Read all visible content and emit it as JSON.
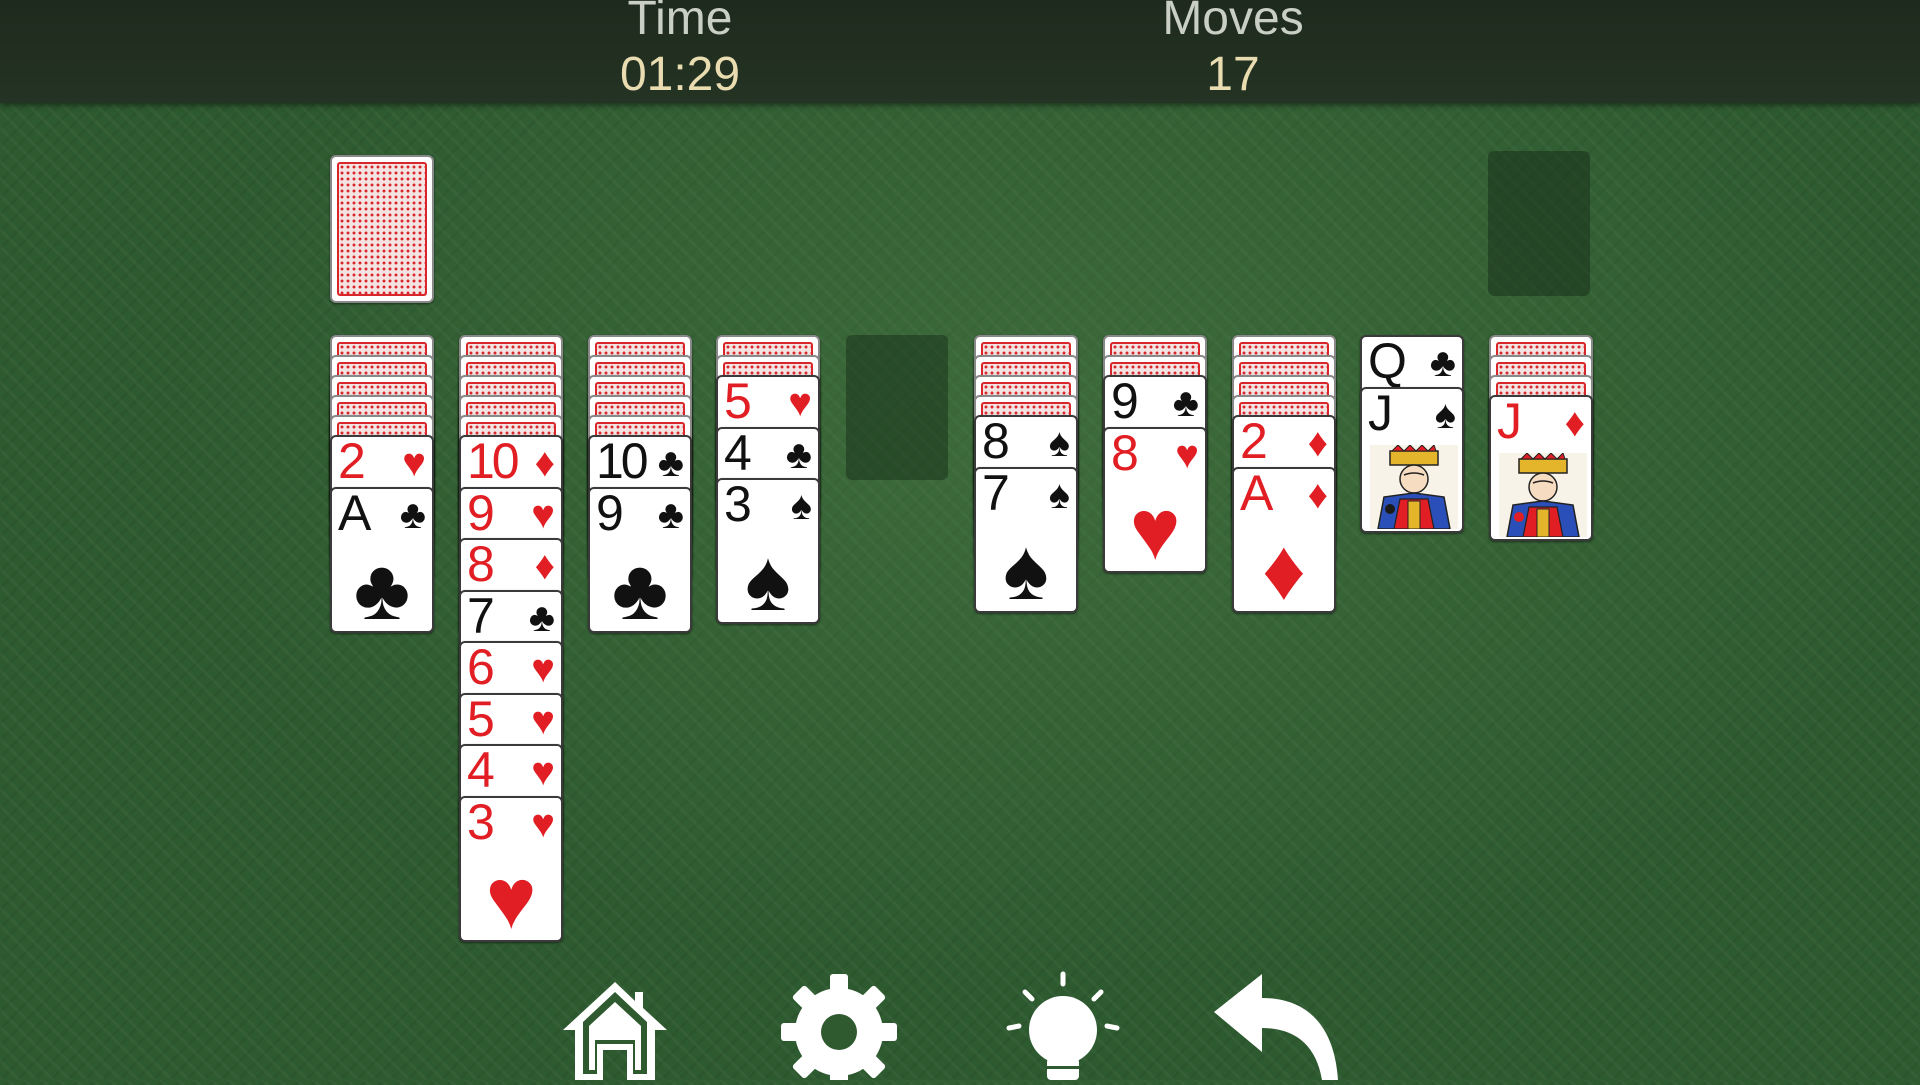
{
  "header": {
    "time_label": "Time",
    "time_value": "01:29",
    "moves_label": "Moves",
    "moves_value": "17"
  },
  "stock": {
    "cards": "face-down"
  },
  "foundation_slot": {
    "state": "empty"
  },
  "tableau": [
    {
      "face_down": 5,
      "cards": [
        {
          "rank": "2",
          "suit": "♥",
          "color": "red"
        },
        {
          "rank": "A",
          "suit": "♣",
          "color": "black"
        }
      ]
    },
    {
      "face_down": 5,
      "cards": [
        {
          "rank": "10",
          "suit": "♦",
          "color": "red"
        },
        {
          "rank": "9",
          "suit": "♥",
          "color": "red"
        },
        {
          "rank": "8",
          "suit": "♦",
          "color": "red"
        },
        {
          "rank": "7",
          "suit": "♣",
          "color": "black"
        },
        {
          "rank": "6",
          "suit": "♥",
          "color": "red"
        },
        {
          "rank": "5",
          "suit": "♥",
          "color": "red"
        },
        {
          "rank": "4",
          "suit": "♥",
          "color": "red"
        },
        {
          "rank": "3",
          "suit": "♥",
          "color": "red"
        }
      ]
    },
    {
      "face_down": 5,
      "cards": [
        {
          "rank": "10",
          "suit": "♣",
          "color": "black"
        },
        {
          "rank": "9",
          "suit": "♣",
          "color": "black"
        }
      ]
    },
    {
      "face_down": 2,
      "cards": [
        {
          "rank": "5",
          "suit": "♥",
          "color": "red"
        },
        {
          "rank": "4",
          "suit": "♣",
          "color": "black"
        },
        {
          "rank": "3",
          "suit": "♠",
          "color": "black"
        }
      ]
    },
    {
      "face_down": 0,
      "cards": []
    },
    {
      "face_down": 4,
      "cards": [
        {
          "rank": "8",
          "suit": "♠",
          "color": "black"
        },
        {
          "rank": "7",
          "suit": "♠",
          "color": "black"
        }
      ]
    },
    {
      "face_down": 2,
      "cards": [
        {
          "rank": "9",
          "suit": "♣",
          "color": "black"
        },
        {
          "rank": "8",
          "suit": "♥",
          "color": "red"
        }
      ]
    },
    {
      "face_down": 4,
      "cards": [
        {
          "rank": "2",
          "suit": "♦",
          "color": "red"
        },
        {
          "rank": "A",
          "suit": "♦",
          "color": "red"
        }
      ]
    },
    {
      "face_down": 0,
      "cards": [
        {
          "rank": "Q",
          "suit": "♣",
          "color": "black"
        },
        {
          "rank": "J",
          "suit": "♠",
          "color": "black"
        }
      ]
    },
    {
      "face_down": 3,
      "cards": [
        {
          "rank": "J",
          "suit": "♦",
          "color": "red"
        }
      ]
    }
  ],
  "toolbar": [
    {
      "icon": "home-icon"
    },
    {
      "icon": "gear-icon"
    },
    {
      "icon": "hint-lightbulb-icon"
    },
    {
      "icon": "undo-arrow-icon"
    }
  ],
  "colors": {
    "felt": "#2e5a30",
    "red_suit": "#e11e24",
    "black_suit": "#111111",
    "value_text": "#e8dcb0"
  }
}
